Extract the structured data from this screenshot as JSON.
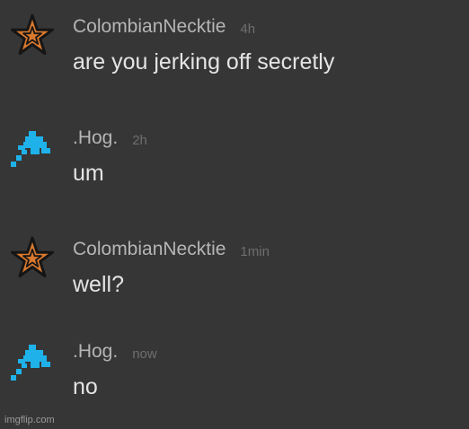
{
  "messages": [
    {
      "author": "ColombianNecktie",
      "time": "4h",
      "text": "are you jerking off secretly",
      "avatar": "orange-star-icon"
    },
    {
      "author": ".Hog.",
      "time": "2h",
      "text": "um",
      "avatar": "blue-pixel-icon"
    },
    {
      "author": "ColombianNecktie",
      "time": "1min",
      "text": "well?",
      "avatar": "orange-star-icon"
    },
    {
      "author": ".Hog.",
      "time": "now",
      "text": "no",
      "avatar": "blue-pixel-icon"
    }
  ],
  "watermark": "imgflip.com",
  "colors": {
    "background": "#363636",
    "author": "#b5b5b5",
    "time": "#6f6f6f",
    "text": "#e4e4e4",
    "star_fill": "#d9792e",
    "pixel_blue": "#1fb2ea"
  }
}
